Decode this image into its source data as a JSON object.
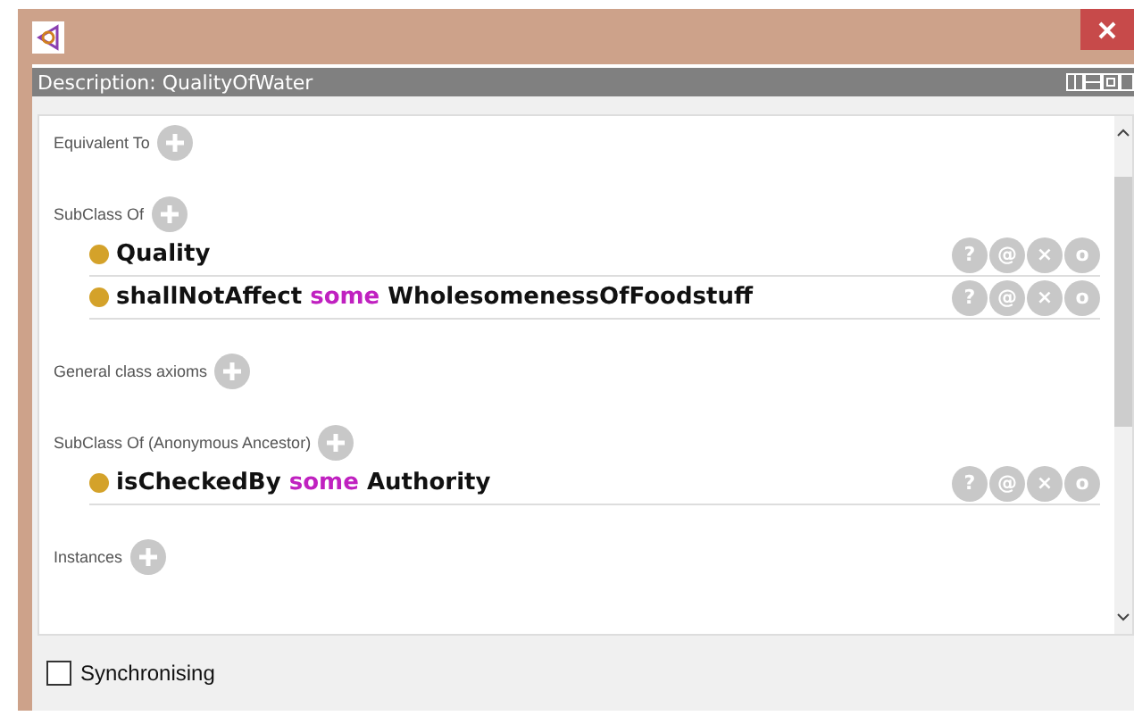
{
  "panel": {
    "title": "Description: QualityOfWater"
  },
  "sections": [
    {
      "label": "Equivalent To"
    },
    {
      "label": "SubClass Of",
      "rows": [
        {
          "parts": [
            {
              "text": "Quality",
              "kind": "entity"
            }
          ],
          "buttons": [
            "?",
            "@",
            "×",
            "o"
          ]
        },
        {
          "parts": [
            {
              "text": "shallNotAffect",
              "kind": "entity"
            },
            {
              "text": "some",
              "kind": "keyword"
            },
            {
              "text": "WholesomenessOfFoodstuff",
              "kind": "entity"
            }
          ],
          "buttons": [
            "?",
            "@",
            "×",
            "o"
          ]
        }
      ]
    },
    {
      "label": "General class axioms"
    },
    {
      "label": "SubClass Of (Anonymous Ancestor)",
      "rows": [
        {
          "parts": [
            {
              "text": "isCheckedBy",
              "kind": "entity"
            },
            {
              "text": "some",
              "kind": "keyword"
            },
            {
              "text": "Authority",
              "kind": "entity"
            }
          ],
          "buttons": [
            "?",
            "@",
            "×",
            "o"
          ]
        }
      ]
    },
    {
      "label": "Instances"
    }
  ],
  "sync": {
    "label": "Synchronising",
    "checked": false
  }
}
